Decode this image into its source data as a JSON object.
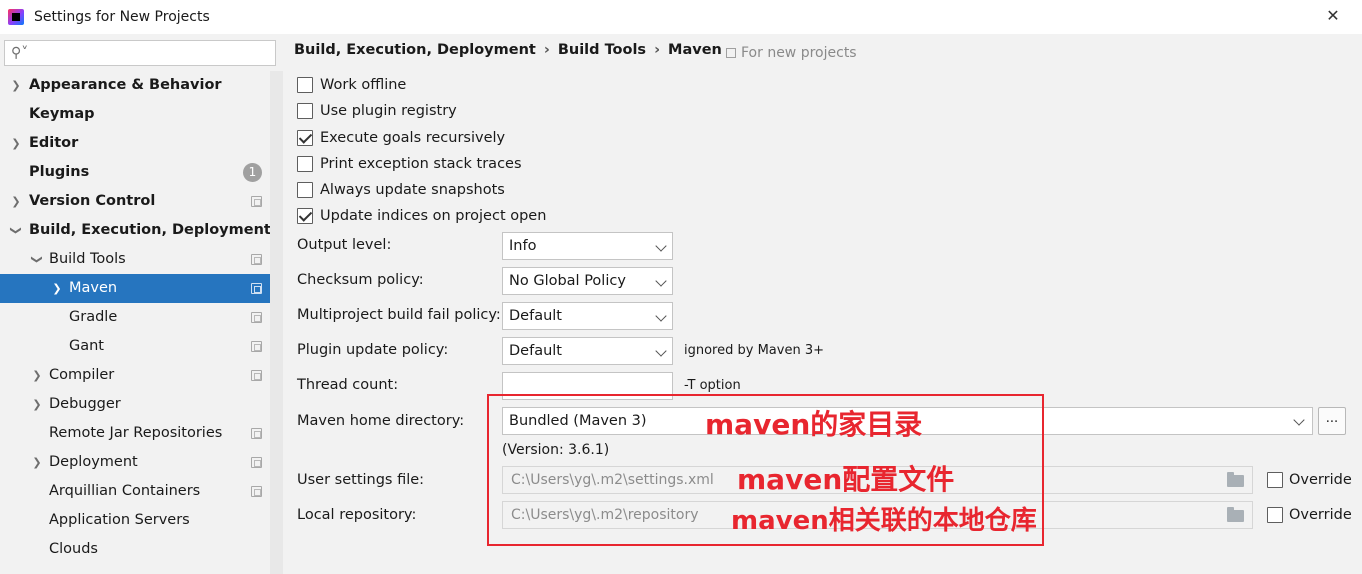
{
  "window": {
    "title": "Settings for New Projects"
  },
  "search": {
    "placeholder": ""
  },
  "sidebar": {
    "items": [
      {
        "label": "Appearance & Behavior"
      },
      {
        "label": "Keymap"
      },
      {
        "label": "Editor"
      },
      {
        "label": "Plugins",
        "badge": "1"
      },
      {
        "label": "Version Control"
      },
      {
        "label": "Build, Execution, Deployment"
      },
      {
        "label": "Build Tools"
      },
      {
        "label": "Maven"
      },
      {
        "label": "Gradle"
      },
      {
        "label": "Gant"
      },
      {
        "label": "Compiler"
      },
      {
        "label": "Debugger"
      },
      {
        "label": "Remote Jar Repositories"
      },
      {
        "label": "Deployment"
      },
      {
        "label": "Arquillian Containers"
      },
      {
        "label": "Application Servers"
      },
      {
        "label": "Clouds"
      }
    ]
  },
  "breadcrumb": {
    "part1": "Build, Execution, Deployment",
    "sep": "›",
    "part2": "Build Tools",
    "part3": "Maven"
  },
  "scope_note": "For new projects",
  "options": {
    "work_offline": {
      "label": "Work offline",
      "checked": false
    },
    "use_plugin_registry": {
      "label": "Use plugin registry",
      "checked": false
    },
    "execute_goals": {
      "label": "Execute goals recursively",
      "checked": true
    },
    "print_exception": {
      "label": "Print exception stack traces",
      "checked": false
    },
    "always_update": {
      "label": "Always update snapshots",
      "checked": false
    },
    "update_indices": {
      "label": "Update indices on project open",
      "checked": true
    }
  },
  "form": {
    "output_level": {
      "label": "Output level:",
      "value": "Info"
    },
    "checksum_policy": {
      "label": "Checksum policy:",
      "value": "No Global Policy"
    },
    "multiproject_fail": {
      "label": "Multiproject build fail policy:",
      "value": "Default"
    },
    "plugin_update": {
      "label": "Plugin update policy:",
      "value": "Default",
      "note": "ignored by Maven 3+"
    },
    "thread_count": {
      "label": "Thread count:",
      "value": "",
      "note": "-T option"
    },
    "maven_home": {
      "label": "Maven home directory:",
      "value": "Bundled (Maven 3)",
      "button": "...",
      "version": "(Version: 3.6.1)"
    },
    "user_settings": {
      "label": "User settings file:",
      "value": "C:\\Users\\yg\\.m2\\settings.xml",
      "override": "Override"
    },
    "local_repo": {
      "label": "Local repository:",
      "value": "C:\\Users\\yg\\.m2\\repository",
      "override": "Override"
    }
  },
  "annotations": {
    "home": "maven的家目录",
    "settings": "maven配置文件",
    "repo": "maven相关联的本地仓库",
    "color": "#e8262f"
  },
  "colors": {
    "selection": "#2675bf",
    "annotation": "#e8262f"
  }
}
